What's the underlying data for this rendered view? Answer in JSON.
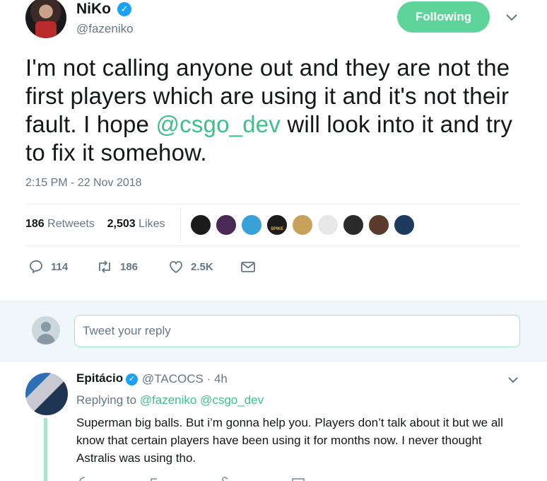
{
  "tweet": {
    "author": {
      "name": "NiKo",
      "handle": "@fazeniko",
      "verified": true
    },
    "follow_button": "Following",
    "text_parts": [
      "I'm not calling anyone out and they are not the first players which are using it and it's not their fault. I hope ",
      "@csgo_dev",
      " will look into it and try to fix it somehow."
    ],
    "timestamp": "2:15 PM - 22 Nov 2018",
    "retweets_count": "186",
    "retweets_label": "Retweets",
    "likes_count": "2,503",
    "likes_label": "Likes",
    "liker_avatars": [
      {
        "color": "#1b1b1b"
      },
      {
        "color": "#4a2a55"
      },
      {
        "color": "#3aa0d8"
      },
      {
        "color": "#1c1c1c",
        "text": "SPIKE"
      },
      {
        "color": "#c7a25a"
      },
      {
        "color": "#e8e8e8"
      },
      {
        "color": "#2a2a2a"
      },
      {
        "color": "#5a3b2c"
      },
      {
        "color": "#1d3b5e"
      }
    ],
    "actions": {
      "replies": "114",
      "retweets": "186",
      "likes": "2.5K"
    }
  },
  "reply_box": {
    "placeholder": "Tweet your reply"
  },
  "reply": {
    "name": "Epitácio",
    "handle": "@TACOCS",
    "time": "· 4h",
    "replying_to_label": "Replying to",
    "replying_to": "@fazeniko @csgo_dev",
    "text": "Superman big balls. But i’m gonna help you. Players don’t talk about it but we all know that certain players have been using it for months now. I never thought Astralis was using tho."
  },
  "colors": {
    "accent": "#3fbf8a",
    "follow_bg": "#5fd49a",
    "verified": "#1da1f2",
    "muted": "#657786"
  }
}
